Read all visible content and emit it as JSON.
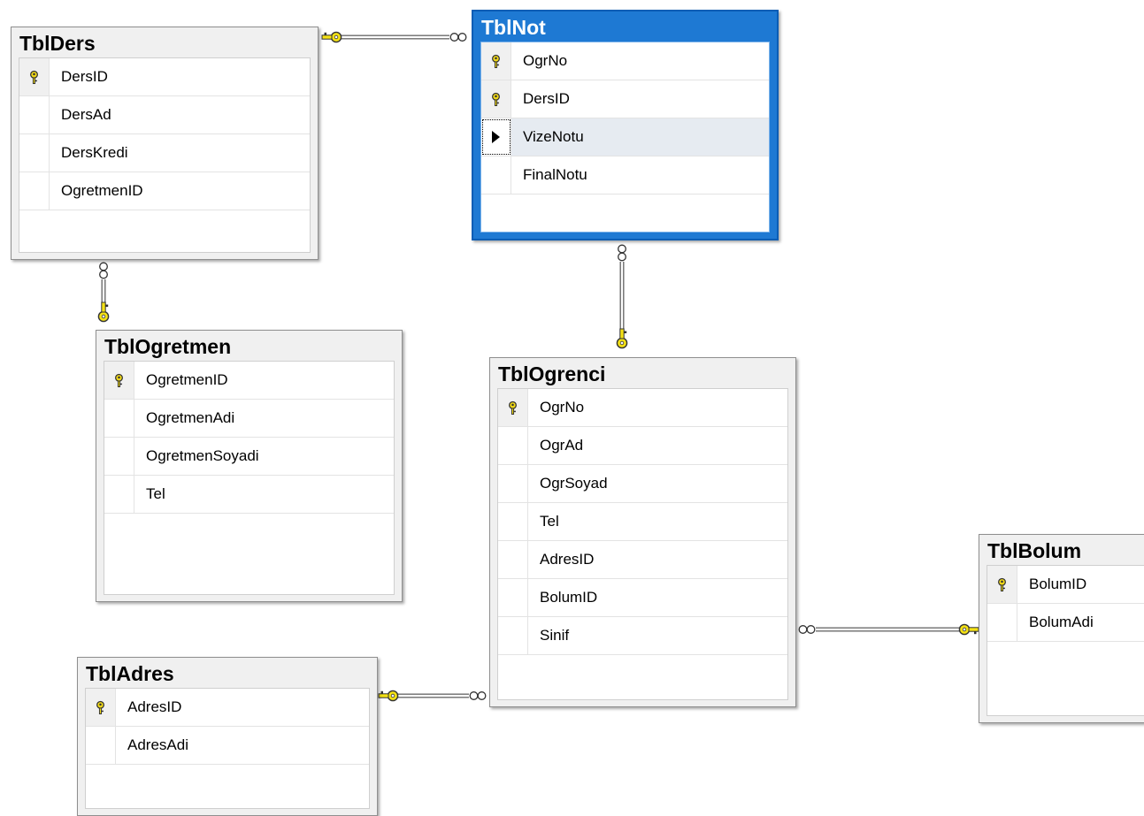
{
  "diagram": {
    "tables": [
      {
        "id": "TblDers",
        "title": "TblDers",
        "selected": false,
        "columns": [
          {
            "name": "DersID",
            "pk": true
          },
          {
            "name": "DersAd",
            "pk": false
          },
          {
            "name": "DersKredi",
            "pk": false
          },
          {
            "name": "OgretmenID",
            "pk": false
          }
        ]
      },
      {
        "id": "TblNot",
        "title": "TblNot",
        "selected": true,
        "columns": [
          {
            "name": "OgrNo",
            "pk": true
          },
          {
            "name": "DersID",
            "pk": true
          },
          {
            "name": "VizeNotu",
            "pk": false,
            "current": true
          },
          {
            "name": "FinalNotu",
            "pk": false
          }
        ]
      },
      {
        "id": "TblOgretmen",
        "title": "TblOgretmen",
        "selected": false,
        "columns": [
          {
            "name": "OgretmenID",
            "pk": true
          },
          {
            "name": "OgretmenAdi",
            "pk": false
          },
          {
            "name": "OgretmenSoyadi",
            "pk": false
          },
          {
            "name": "Tel",
            "pk": false
          }
        ]
      },
      {
        "id": "TblOgrenci",
        "title": "TblOgrenci",
        "selected": false,
        "columns": [
          {
            "name": "OgrNo",
            "pk": true
          },
          {
            "name": "OgrAd",
            "pk": false
          },
          {
            "name": "OgrSoyad",
            "pk": false
          },
          {
            "name": "Tel",
            "pk": false
          },
          {
            "name": "AdresID",
            "pk": false
          },
          {
            "name": "BolumID",
            "pk": false
          },
          {
            "name": "Sinif",
            "pk": false
          }
        ]
      },
      {
        "id": "TblBolum",
        "title": "TblBolum",
        "selected": false,
        "columns": [
          {
            "name": "BolumID",
            "pk": true
          },
          {
            "name": "BolumAdi",
            "pk": false
          }
        ]
      },
      {
        "id": "TblAdres",
        "title": "TblAdres",
        "selected": false,
        "columns": [
          {
            "name": "AdresID",
            "pk": true
          },
          {
            "name": "AdresAdi",
            "pk": false
          }
        ]
      }
    ],
    "relationships": [
      {
        "one": "TblDers",
        "many": "TblNot"
      },
      {
        "one": "TblOgretmen",
        "many": "TblDers"
      },
      {
        "one": "TblOgrenci",
        "many": "TblNot"
      },
      {
        "one": "TblAdres",
        "many": "TblOgrenci"
      },
      {
        "one": "TblBolum",
        "many": "TblOgrenci"
      }
    ],
    "icons": {
      "primary_key": "key-icon",
      "row_selector": "row-pointer-icon",
      "one_end": "key-icon",
      "many_end": "infinity-icon"
    },
    "colors": {
      "selected_header": "#1e79d3",
      "relationship_key": "#f5e214"
    }
  }
}
